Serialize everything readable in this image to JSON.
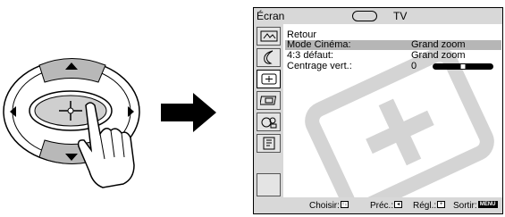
{
  "osd": {
    "title": "Écran",
    "tv_label": "TV",
    "menu_items": [
      {
        "label": "Retour",
        "value": "",
        "highlighted": false
      },
      {
        "label": "Mode Cinéma:",
        "value": "Grand zoom",
        "highlighted": true
      },
      {
        "label": "4:3 défaut:",
        "value": "Grand zoom",
        "highlighted": false
      },
      {
        "label": "Centrage vert.:",
        "value": "0",
        "highlighted": false
      }
    ],
    "centrage_level": 0,
    "footer": {
      "choisir": "Choisir:",
      "prec": "Préc.:",
      "regl": "Régl.:",
      "sortir": "Sortir:",
      "menu_key": "MENU"
    },
    "sidebar_icons": [
      "picture-icon",
      "sound-icon",
      "screen-icon",
      "setup-icon",
      "features-icon",
      "preset-icon"
    ]
  },
  "colors": {
    "osd_background": "#d8d8d8",
    "highlight": "#b6b6b6",
    "panel": "#ffffff"
  }
}
